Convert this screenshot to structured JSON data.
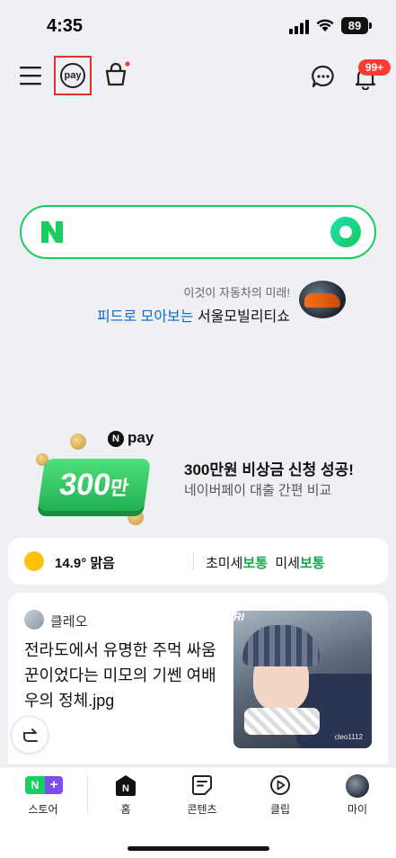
{
  "status_bar": {
    "time": "4:35",
    "battery": "89"
  },
  "header": {
    "pay_label": "pay",
    "notification_count": "99+"
  },
  "promo": {
    "subtitle": "이것이 자동차의 미래!",
    "highlight": "피드로 모아보는",
    "main": "서울모빌리티쇼"
  },
  "ad": {
    "amount_number": "300",
    "amount_unit": "만",
    "npay_mark": "N",
    "npay_text": "pay",
    "title": "300만원 비상금 신청 성공!",
    "subtitle": "네이버페이 대출 간편 비교"
  },
  "weather": {
    "temp_condition": "14.9° 맑음",
    "fine_dust_label": "초미세",
    "fine_dust_value": "보통",
    "dust_label": "미세",
    "dust_value": "보통"
  },
  "feed": {
    "author": "클레오",
    "title": "전라도에서 유명한 주먹 싸움꾼이었다는 미모의 기쎈 여배우의 정체.jpg",
    "thumb_caption": "RI",
    "thumb_watermark": "cleo1112"
  },
  "nav": {
    "store_n": "N",
    "store_plus": "+",
    "store": "스토어",
    "home_n": "N",
    "home": "홈",
    "contents": "콘텐츠",
    "clip": "클립",
    "my": "마이"
  },
  "colors": {
    "naver_green": "#19ce60",
    "highlight_blue": "#0d68c9",
    "badge_red": "#ff3b30",
    "good_green": "#1aa64a"
  }
}
